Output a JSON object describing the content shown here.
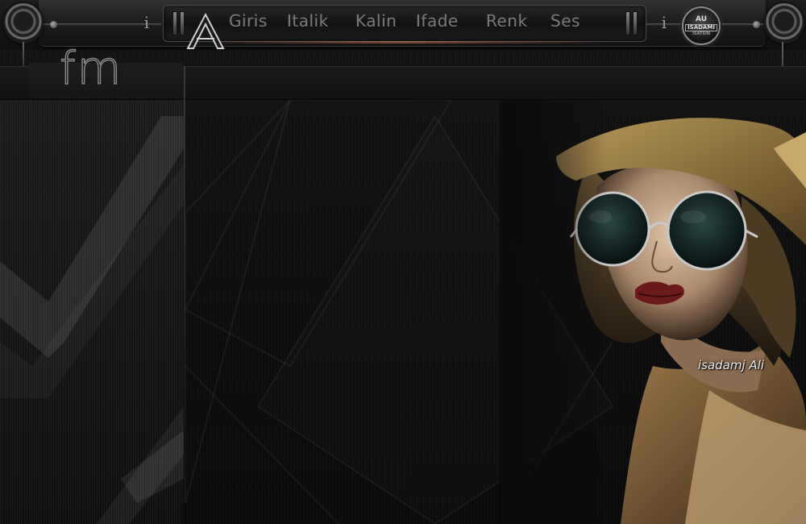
{
  "toolbar": {
    "logo_letter": "A",
    "menu": [
      "Giris",
      "Italik",
      "Kalin",
      "Ifade",
      "Renk",
      "Ses"
    ],
    "info_left": "i",
    "info_right": "i",
    "badge": {
      "line1": "AU",
      "line2": "ISADAMI",
      "line3": "ISATSIN"
    }
  },
  "header": {
    "logo_text": "fm"
  },
  "art": {
    "signature": "isadamj Ali"
  },
  "colors": {
    "background": "#0b0b0b",
    "menu_text": "#7a7a7a",
    "glow": "#ff8c64"
  }
}
